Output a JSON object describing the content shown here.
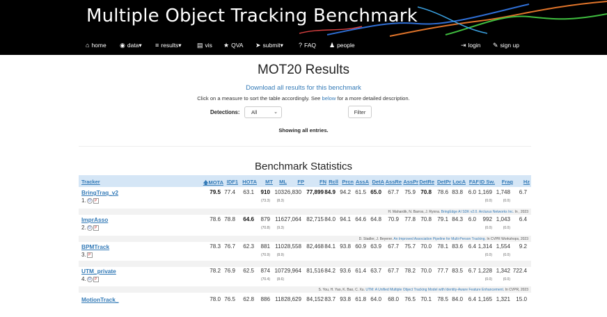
{
  "banner": {
    "title": "Multiple Object Tracking Benchmark"
  },
  "nav": {
    "left": [
      {
        "icon": "home-icon",
        "glyph": "⌂",
        "label": "home"
      },
      {
        "icon": "data-icon",
        "glyph": "◉",
        "label": "data▾"
      },
      {
        "icon": "list-icon",
        "glyph": "≡",
        "label": "results▾"
      },
      {
        "icon": "film-icon",
        "glyph": "▤",
        "label": "vis"
      },
      {
        "icon": "star-icon",
        "glyph": "★",
        "label": "QVA"
      },
      {
        "icon": "send-icon",
        "glyph": "➤",
        "label": "submit▾"
      },
      {
        "icon": "question-icon",
        "glyph": "?",
        "label": "FAQ"
      },
      {
        "icon": "user-icon",
        "glyph": "♟",
        "label": "people"
      }
    ],
    "right": [
      {
        "icon": "login-icon",
        "glyph": "⇥",
        "label": "login"
      },
      {
        "icon": "pencil-icon",
        "glyph": "✎",
        "label": "sign up"
      }
    ]
  },
  "page": {
    "title": "MOT20 Results",
    "download": "Download all results for this benchmark",
    "hint_pre": "Click on a measure to sort the table accordingly. See ",
    "hint_link": "below",
    "hint_post": " for a more detailed description.",
    "detections_label": "Detections:",
    "detections_value": "All",
    "filter_label": "Filter",
    "showing": "Showing all entries."
  },
  "stats": {
    "title": "Benchmark Statistics",
    "columns": [
      "Tracker",
      "🡅MOTA",
      "IDF1",
      "HOTA",
      "MT",
      "ML",
      "FP",
      "FN",
      "Rcll",
      "Prcn",
      "AssA",
      "DetA",
      "AssRe",
      "AssPr",
      "DetRe",
      "DetPr",
      "LocA",
      "FAF",
      "ID Sw.",
      "Frag",
      "Hz"
    ],
    "rows": [
      {
        "name": "BringTraq_v2",
        "rank": "1.",
        "round_icon": true,
        "values": [
          "79.5",
          "77.4",
          "63.1",
          "910",
          "103",
          "26,830",
          "77,899",
          "84.9",
          "94.2",
          "61.5",
          "65.0",
          "67.7",
          "75.9",
          "70.8",
          "78.6",
          "83.8",
          "6.0",
          "1,169",
          "1,748",
          "6.7"
        ],
        "bold": [
          0,
          3,
          6,
          7,
          10,
          13
        ],
        "mt_sub": "(73.3)",
        "ml_sub": "(8.3)",
        "id_sub": "(0.0)",
        "frag_sub": "(0.0)",
        "ref_authors": "H. Mahardik, N. Barros, J. Rynna. ",
        "ref_title": "BringEdge AI SDK v2.0. Arcturus Networks Inc.",
        "ref_year": " In , 2023"
      },
      {
        "name": "ImprAsso",
        "rank": "2.",
        "round_icon": true,
        "values": [
          "78.6",
          "78.8",
          "64.6",
          "879",
          "116",
          "27,064",
          "82,715",
          "84.0",
          "94.1",
          "64.6",
          "64.8",
          "70.9",
          "77.8",
          "70.8",
          "79.1",
          "84.3",
          "6.0",
          "992",
          "1,043",
          "6.4"
        ],
        "bold": [
          2
        ],
        "mt_sub": "(70.8)",
        "ml_sub": "(9.3)",
        "id_sub": "(0.0)",
        "frag_sub": "(0.0)",
        "ref_authors": "D. Stadler, J. Beyerer. ",
        "ref_title": "An Improved Association Pipeline for Multi-Person Tracking.",
        "ref_year": " In CVPR Workshops, 2023"
      },
      {
        "name": "BPMTrack",
        "rank": "3.",
        "round_icon": false,
        "values": [
          "78.3",
          "76.7",
          "62.3",
          "881",
          "110",
          "28,558",
          "82,468",
          "84.1",
          "93.8",
          "60.9",
          "63.9",
          "67.7",
          "75.7",
          "70.0",
          "78.1",
          "83.6",
          "6.4",
          "1,314",
          "1,554",
          "9.2"
        ],
        "bold": [],
        "mt_sub": "(70.9)",
        "ml_sub": "(8.9)",
        "id_sub": "(0.0)",
        "frag_sub": "(0.0)",
        "ref_authors": "",
        "ref_title": "",
        "ref_year": ""
      },
      {
        "name": "UTM_private",
        "rank": "4.",
        "round_icon": true,
        "values": [
          "78.2",
          "76.9",
          "62.5",
          "874",
          "107",
          "29,964",
          "81,516",
          "84.2",
          "93.6",
          "61.4",
          "63.7",
          "67.7",
          "78.2",
          "70.0",
          "77.7",
          "83.5",
          "6.7",
          "1,228",
          "1,342",
          "722.4"
        ],
        "bold": [],
        "mt_sub": "(70.4)",
        "ml_sub": "(8.6)",
        "id_sub": "(0.0)",
        "frag_sub": "(0.0)",
        "ref_authors": "S. You, H. Yao, K. Bao, C. Xu. ",
        "ref_title": "UTM: A Unified Multiple Object Tracking Model with Identity-Aware Feature Enhancement.",
        "ref_year": " In CVPR, 2023"
      },
      {
        "name": "MotionTrack_",
        "rank": "",
        "round_icon": false,
        "values": [
          "78.0",
          "76.5",
          "62.8",
          "886",
          "118",
          "28,629",
          "84,152",
          "83.7",
          "93.8",
          "61.8",
          "64.0",
          "68.0",
          "76.5",
          "70.1",
          "78.5",
          "84.0",
          "6.4",
          "1,165",
          "1,321",
          "15.0"
        ],
        "bold": [],
        "mt_sub": "",
        "ml_sub": "",
        "id_sub": "",
        "frag_sub": "",
        "ref_authors": "",
        "ref_title": "",
        "ref_year": ""
      }
    ]
  },
  "colors": {
    "header_bg": "#000000",
    "link": "#337ab7",
    "table_head_bg": "#d5e6f6"
  }
}
